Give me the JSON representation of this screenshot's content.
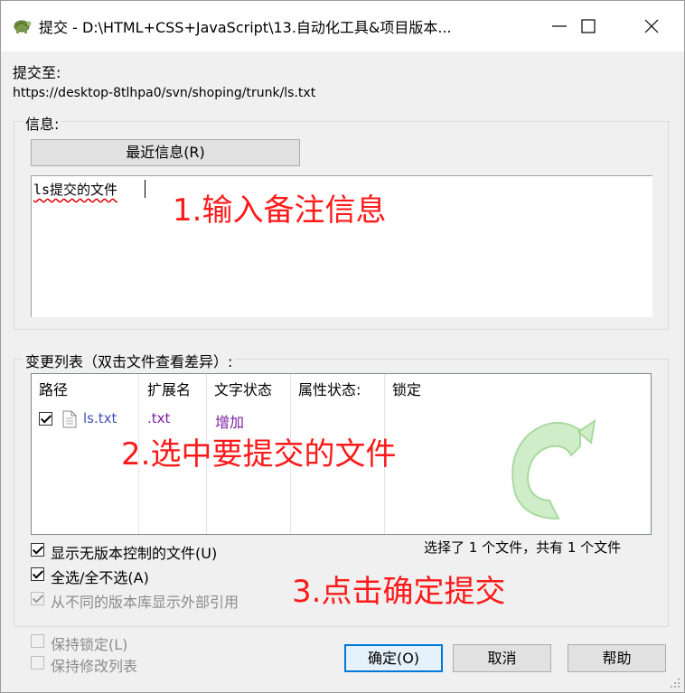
{
  "window": {
    "title": "提交 - D:\\HTML+CSS+JavaScript\\13.自动化工具&项目版本...",
    "icon": "tortoise-icon"
  },
  "titlebar_buttons": {
    "minimize": "minimize-icon",
    "maximize": "maximize-icon",
    "close": "close-icon"
  },
  "commit_to": {
    "label": "提交至:",
    "url": "https://desktop-8tlhpa0/svn/shoping/trunk/ls.txt"
  },
  "message": {
    "group_label": "信息:",
    "recent_button": "最近信息(R)",
    "text": "ls提交的文件"
  },
  "annotations": {
    "step1": "1.输入备注信息",
    "step2": "2.选中要提交的文件",
    "step3": "3.点击确定提交",
    "color": "#ff1a1a"
  },
  "changes": {
    "group_label": "变更列表（双击文件查看差异）:",
    "columns": [
      "路径",
      "扩展名",
      "文字状态",
      "属性状态:",
      "锁定"
    ],
    "rows": [
      {
        "checked": true,
        "path": "ls.txt",
        "extension": ".txt",
        "text_status": "增加",
        "property_status": "",
        "lock": ""
      }
    ],
    "status_color": "#7b1fa2",
    "path_color": "#3f51b5",
    "summary": "选择了 1 个文件，共有 1 个文件"
  },
  "options": {
    "show_unversioned": {
      "label": "显示无版本控制的文件(U)",
      "checked": true,
      "enabled": true
    },
    "select_all": {
      "label": "全选/全不选(A)",
      "checked": true,
      "enabled": true
    },
    "show_externals": {
      "label": "从不同的版本库显示外部引用",
      "checked": true,
      "enabled": false
    },
    "keep_locks": {
      "label": "保持锁定(L)",
      "checked": false,
      "enabled": false
    },
    "keep_changelists": {
      "label": "保持修改列表",
      "checked": false,
      "enabled": false
    }
  },
  "buttons": {
    "ok": "确定(O)",
    "cancel": "取消",
    "help": "帮助"
  },
  "watermark_icon": "tortoisesvn-logo-icon"
}
